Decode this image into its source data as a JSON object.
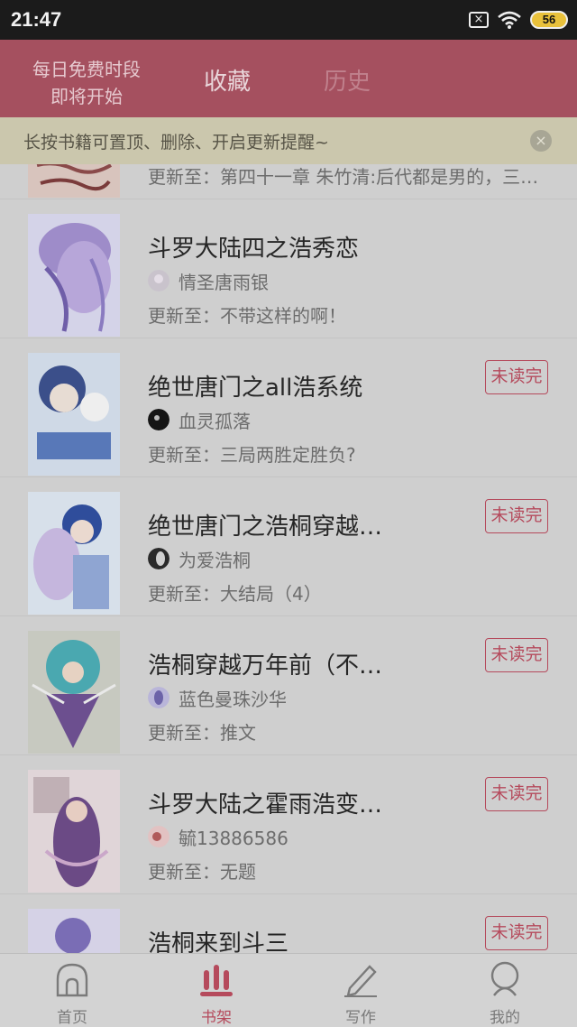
{
  "status_bar": {
    "time": "21:47",
    "battery": "56"
  },
  "header": {
    "promo_line1": "每日免费时段",
    "promo_line2": "即将开始",
    "tab_favorites": "收藏",
    "tab_history": "历史"
  },
  "tip": {
    "text": "长按书籍可置顶、删除、开启更新提醒~"
  },
  "books": [
    {
      "title": "",
      "author": "",
      "update": "更新至：第四十一章 朱竹清:后代都是男的，三…",
      "badge": ""
    },
    {
      "title": "斗罗大陆四之浩秀恋",
      "author": "情圣唐雨银",
      "update": "更新至：不带这样的啊！",
      "badge": ""
    },
    {
      "title": "绝世唐门之all浩系统",
      "author": "血灵孤落",
      "update": "更新至：三局两胜定胜负?",
      "badge": "未读完"
    },
    {
      "title": "绝世唐门之浩桐穿越…",
      "author": "为爱浩桐",
      "update": "更新至：大结局（4）",
      "badge": "未读完"
    },
    {
      "title": "浩桐穿越万年前（不…",
      "author": "蓝色曼珠沙华",
      "update": "更新至：推文",
      "badge": "未读完"
    },
    {
      "title": "斗罗大陆之霍雨浩变…",
      "author": "毓13886586",
      "update": "更新至：无题",
      "badge": "未读完"
    },
    {
      "title": "浩桐来到斗三",
      "author": "",
      "update": "",
      "badge": "未读完"
    }
  ],
  "nav": {
    "home": "首页",
    "shelf": "书架",
    "write": "写作",
    "mine": "我的"
  },
  "colors": {
    "accent": "#b54a5c",
    "header": "#a5505f"
  }
}
